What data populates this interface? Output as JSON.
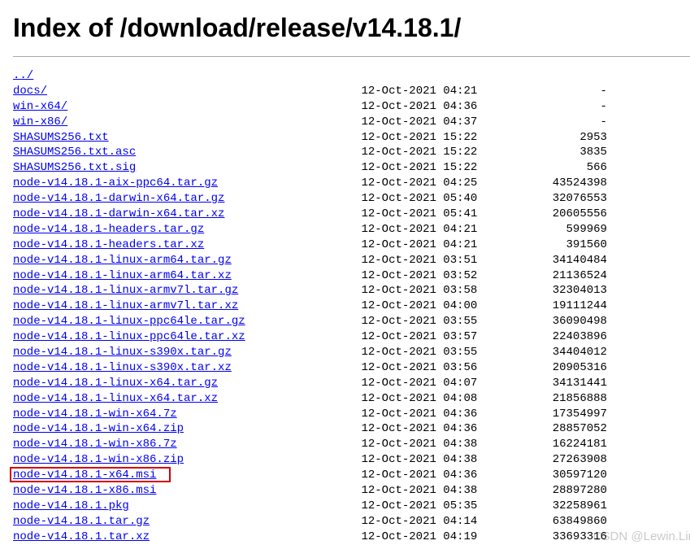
{
  "title": "Index of /download/release/v14.18.1/",
  "parent_link": "../",
  "entries": [
    {
      "name": "docs/",
      "date": "12-Oct-2021 04:21",
      "size": "-"
    },
    {
      "name": "win-x64/",
      "date": "12-Oct-2021 04:36",
      "size": "-"
    },
    {
      "name": "win-x86/",
      "date": "12-Oct-2021 04:37",
      "size": "-"
    },
    {
      "name": "SHASUMS256.txt",
      "date": "12-Oct-2021 15:22",
      "size": "2953"
    },
    {
      "name": "SHASUMS256.txt.asc",
      "date": "12-Oct-2021 15:22",
      "size": "3835"
    },
    {
      "name": "SHASUMS256.txt.sig",
      "date": "12-Oct-2021 15:22",
      "size": "566"
    },
    {
      "name": "node-v14.18.1-aix-ppc64.tar.gz",
      "date": "12-Oct-2021 04:25",
      "size": "43524398"
    },
    {
      "name": "node-v14.18.1-darwin-x64.tar.gz",
      "date": "12-Oct-2021 05:40",
      "size": "32076553"
    },
    {
      "name": "node-v14.18.1-darwin-x64.tar.xz",
      "date": "12-Oct-2021 05:41",
      "size": "20605556"
    },
    {
      "name": "node-v14.18.1-headers.tar.gz",
      "date": "12-Oct-2021 04:21",
      "size": "599969"
    },
    {
      "name": "node-v14.18.1-headers.tar.xz",
      "date": "12-Oct-2021 04:21",
      "size": "391560"
    },
    {
      "name": "node-v14.18.1-linux-arm64.tar.gz",
      "date": "12-Oct-2021 03:51",
      "size": "34140484"
    },
    {
      "name": "node-v14.18.1-linux-arm64.tar.xz",
      "date": "12-Oct-2021 03:52",
      "size": "21136524"
    },
    {
      "name": "node-v14.18.1-linux-armv7l.tar.gz",
      "date": "12-Oct-2021 03:58",
      "size": "32304013"
    },
    {
      "name": "node-v14.18.1-linux-armv7l.tar.xz",
      "date": "12-Oct-2021 04:00",
      "size": "19111244"
    },
    {
      "name": "node-v14.18.1-linux-ppc64le.tar.gz",
      "date": "12-Oct-2021 03:55",
      "size": "36090498"
    },
    {
      "name": "node-v14.18.1-linux-ppc64le.tar.xz",
      "date": "12-Oct-2021 03:57",
      "size": "22403896"
    },
    {
      "name": "node-v14.18.1-linux-s390x.tar.gz",
      "date": "12-Oct-2021 03:55",
      "size": "34404012"
    },
    {
      "name": "node-v14.18.1-linux-s390x.tar.xz",
      "date": "12-Oct-2021 03:56",
      "size": "20905316"
    },
    {
      "name": "node-v14.18.1-linux-x64.tar.gz",
      "date": "12-Oct-2021 04:07",
      "size": "34131441"
    },
    {
      "name": "node-v14.18.1-linux-x64.tar.xz",
      "date": "12-Oct-2021 04:08",
      "size": "21856888"
    },
    {
      "name": "node-v14.18.1-win-x64.7z",
      "date": "12-Oct-2021 04:36",
      "size": "17354997"
    },
    {
      "name": "node-v14.18.1-win-x64.zip",
      "date": "12-Oct-2021 04:36",
      "size": "28857052"
    },
    {
      "name": "node-v14.18.1-win-x86.7z",
      "date": "12-Oct-2021 04:38",
      "size": "16224181"
    },
    {
      "name": "node-v14.18.1-win-x86.zip",
      "date": "12-Oct-2021 04:38",
      "size": "27263908"
    },
    {
      "name": "node-v14.18.1-x64.msi",
      "date": "12-Oct-2021 04:36",
      "size": "30597120",
      "highlighted": true
    },
    {
      "name": "node-v14.18.1-x86.msi",
      "date": "12-Oct-2021 04:38",
      "size": "28897280"
    },
    {
      "name": "node-v14.18.1.pkg",
      "date": "12-Oct-2021 05:35",
      "size": "32258961"
    },
    {
      "name": "node-v14.18.1.tar.gz",
      "date": "12-Oct-2021 04:14",
      "size": "63849860"
    },
    {
      "name": "node-v14.18.1.tar.xz",
      "date": "12-Oct-2021 04:19",
      "size": "33693316"
    }
  ],
  "layout": {
    "name_width": 51,
    "date_width": 17,
    "size_width": 19
  },
  "watermark": "CSDN @Lewin.Lin"
}
